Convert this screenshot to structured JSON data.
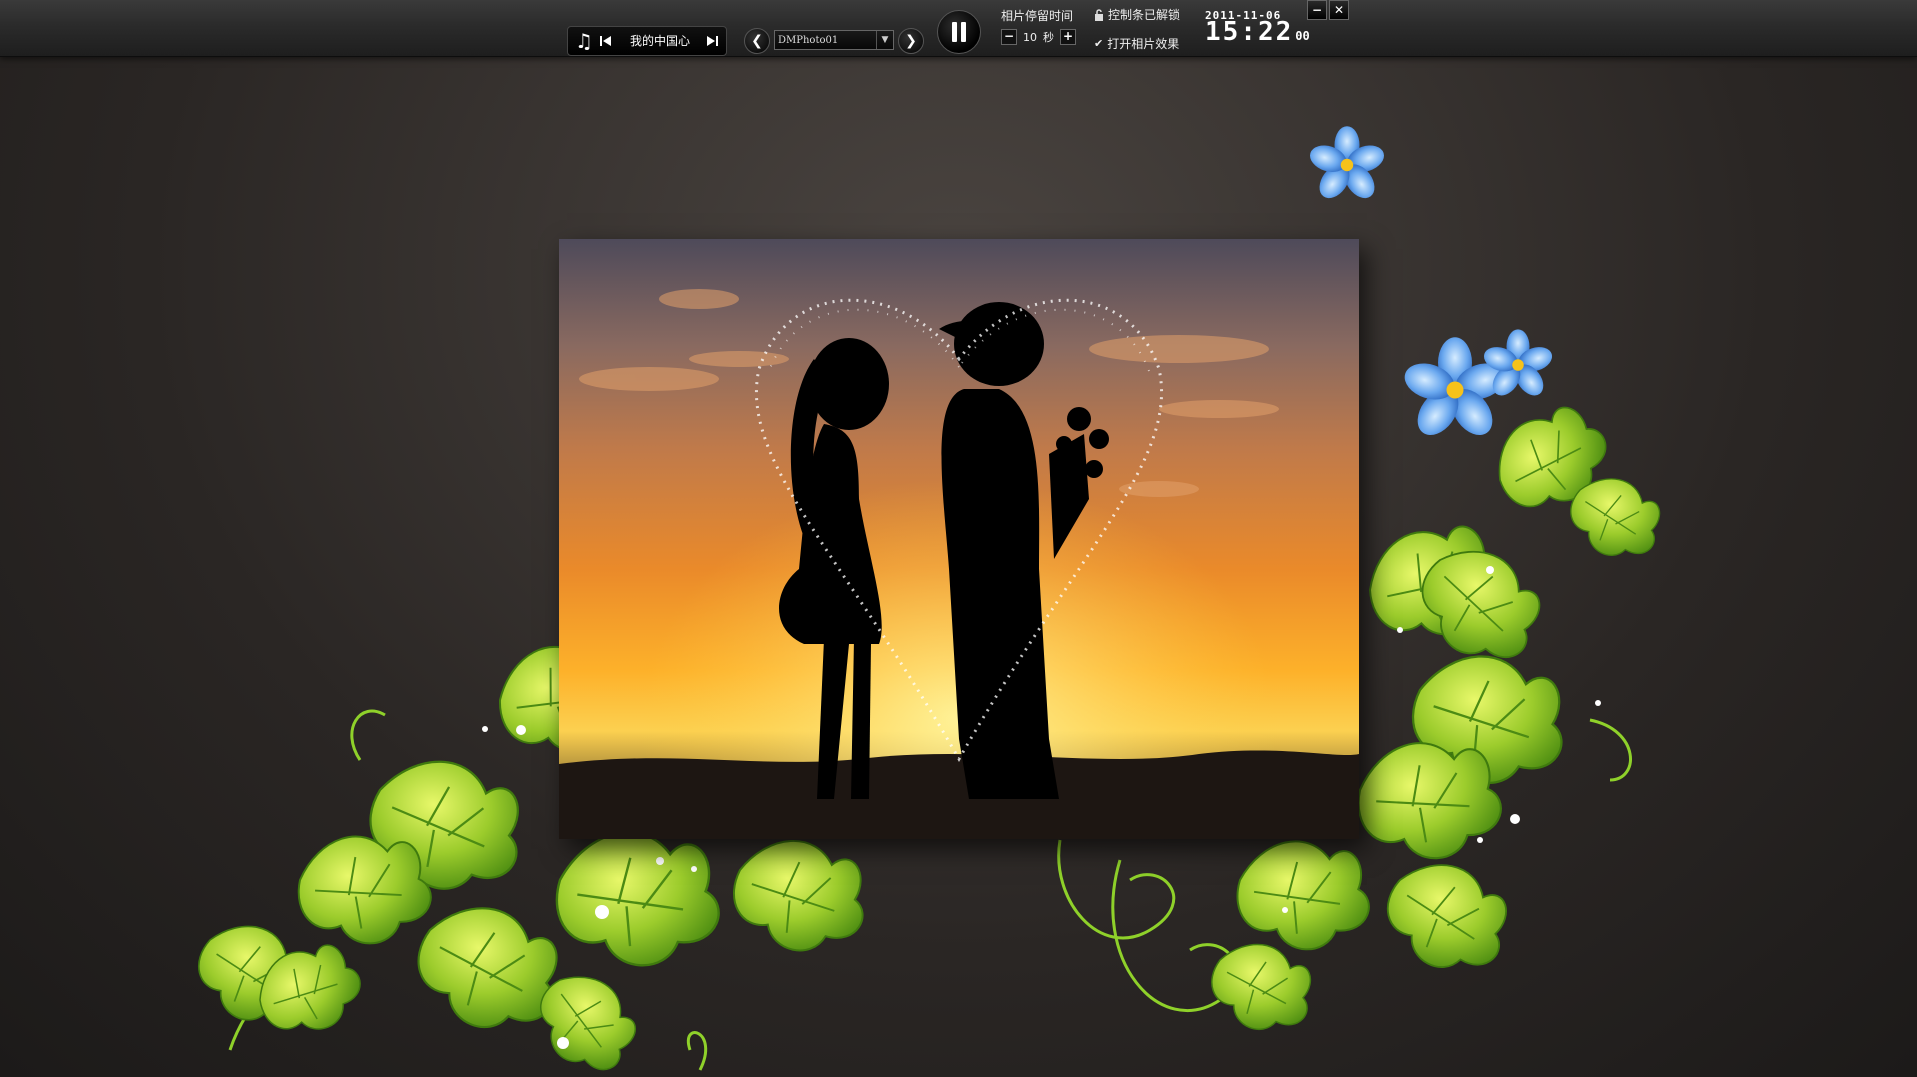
{
  "toolbar": {
    "music_icon": "music-note-icon",
    "song_title": "我的中国心",
    "album_value": "DMPhoto01",
    "stay_label": "相片停留时间",
    "stay_seconds": "10",
    "stay_unit": "秒",
    "lock_label": "控制条已解锁",
    "effect_label": "打开相片效果",
    "date": "2011-11-06",
    "time_hm": "15:22",
    "time_sec": "00",
    "minimize": "−",
    "close": "✕",
    "minus": "−",
    "plus": "+",
    "prev_album": "❮",
    "next_album": "❯"
  },
  "colors": {
    "leaf_green": "#8cc63f",
    "flower_blue": "#5b9ce6",
    "sky_orange": "#f28a1c"
  }
}
